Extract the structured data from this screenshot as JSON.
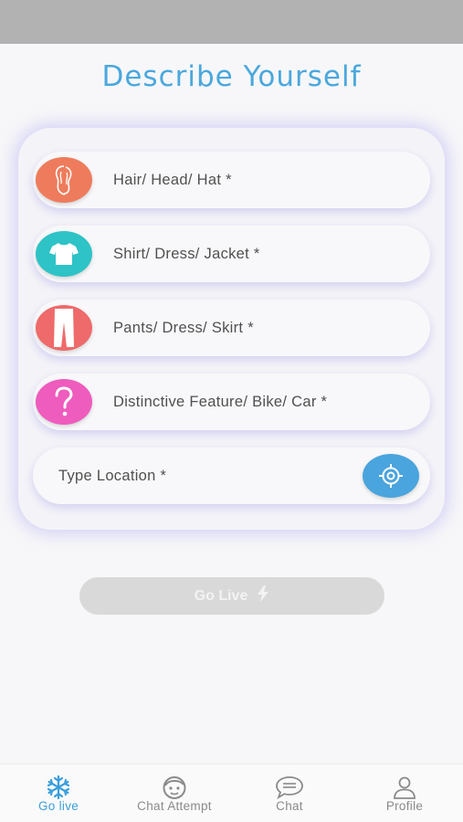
{
  "page": {
    "title": "Describe Yourself"
  },
  "fields": [
    {
      "label": "Hair/ Head/ Hat *",
      "icon": "hair-icon",
      "color": "#ee7c5c"
    },
    {
      "label": "Shirt/ Dress/ Jacket *",
      "icon": "shirt-icon",
      "color": "#2ec3c6"
    },
    {
      "label": "Pants/ Dress/ Skirt *",
      "icon": "pants-icon",
      "color": "#ef6a6a"
    },
    {
      "label": "Distinctive Feature/ Bike/ Car *",
      "icon": "question-icon",
      "color": "#ee5cbd"
    }
  ],
  "location": {
    "placeholder": "Type Location *",
    "icon": "target-icon",
    "color": "#4aa4dd"
  },
  "go_live_button": {
    "label": "Go Live",
    "icon": "lightning-icon"
  },
  "bottom_nav": {
    "items": [
      {
        "label": "Go live",
        "icon": "snowflake-icon",
        "active": true
      },
      {
        "label": "Chat Attempt",
        "icon": "face-icon",
        "active": false
      },
      {
        "label": "Chat",
        "icon": "chat-bubble-icon",
        "active": false
      },
      {
        "label": "Profile",
        "icon": "person-icon",
        "active": false
      }
    ]
  },
  "colors": {
    "accent": "#4aa8dd",
    "status_bar": "#b2b2b2",
    "button_disabled": "#d9d9d9"
  }
}
